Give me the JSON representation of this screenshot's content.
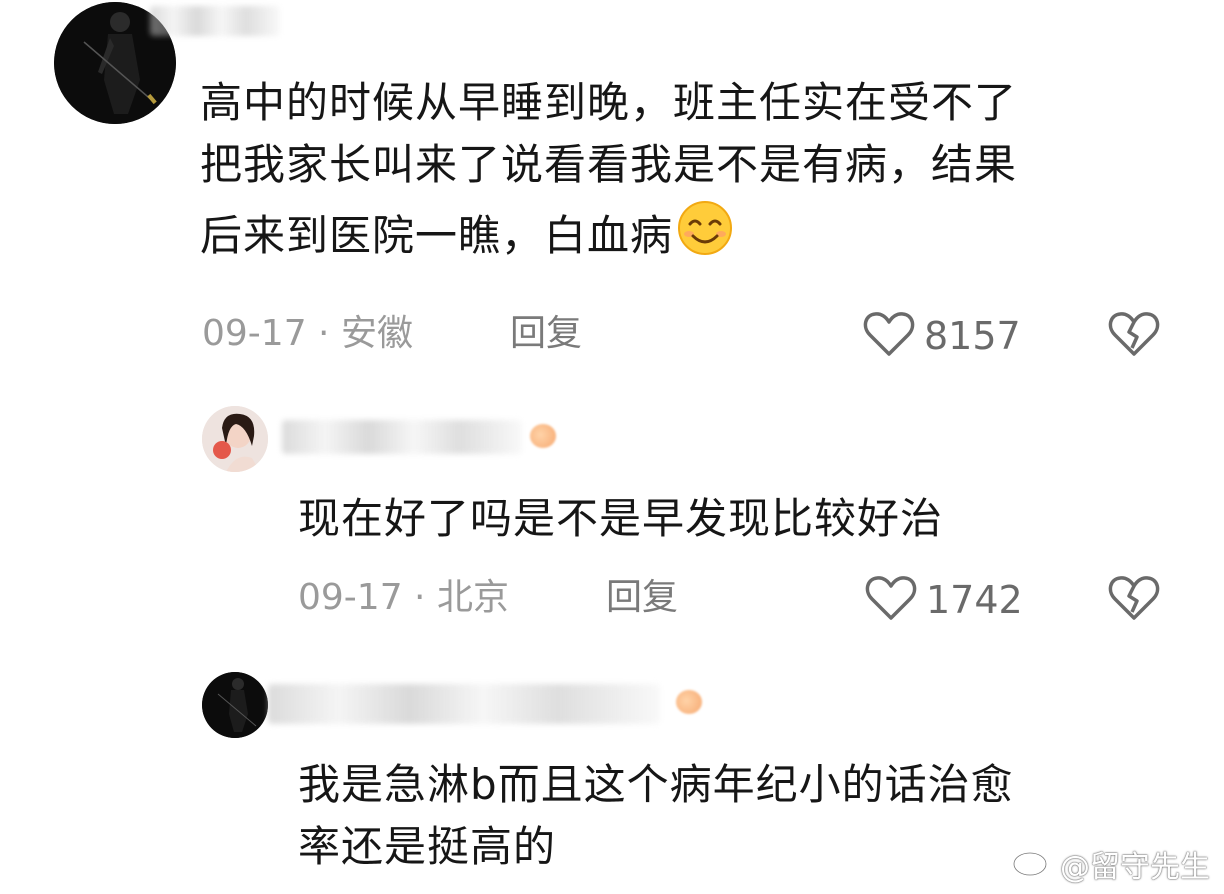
{
  "comments": [
    {
      "text_lines": [
        "高中的时候从早睡到晚，班主任实在受不了",
        "把我家长叫来了说看看我是不是有病，结果",
        "后来到医院一瞧，白血病"
      ],
      "emoji": "smiling-face-emoji",
      "date": "09-17",
      "location": "安徽",
      "reply_label": "回复",
      "likes": "8157"
    },
    {
      "text_lines": [
        "现在好了吗是不是早发现比较好治"
      ],
      "date": "09-17",
      "location": "北京",
      "reply_label": "回复",
      "likes": "1742"
    },
    {
      "text_lines": [
        "我是急淋b而且这个病年纪小的话治愈",
        "率还是挺高的"
      ]
    }
  ],
  "meta_separator": " · ",
  "watermark": {
    "label": "@留守先生",
    "icon": "weibo-logo-icon"
  },
  "colors": {
    "text": "#161616",
    "meta": "#9a9a9a",
    "icon": "#6a6a6a"
  }
}
